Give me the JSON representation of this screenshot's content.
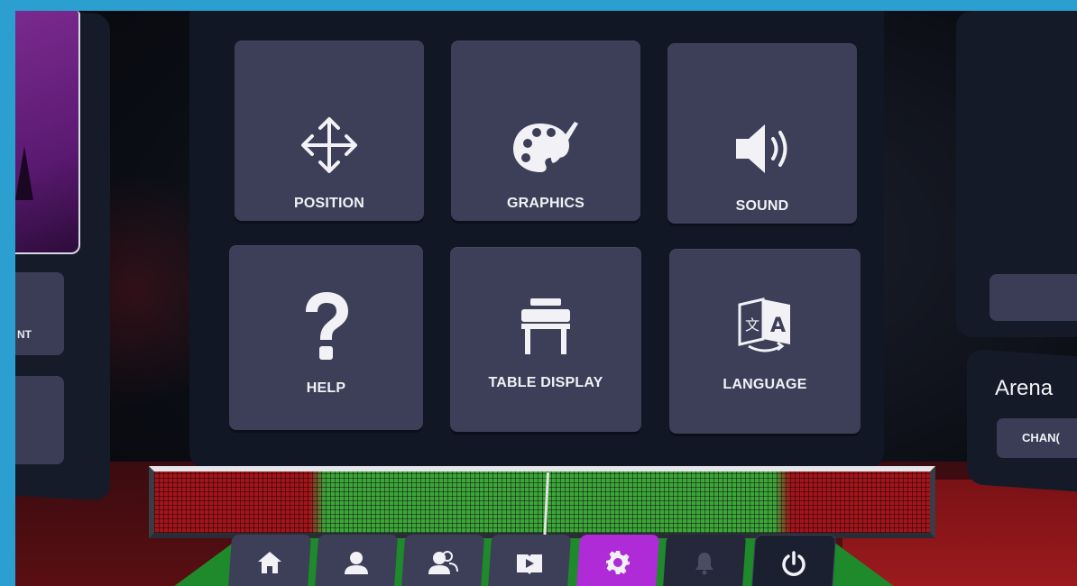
{
  "menu": {
    "tiles": [
      {
        "label": "POSITION",
        "icon": "move-arrows-icon"
      },
      {
        "label": "GRAPHICS",
        "icon": "palette-icon"
      },
      {
        "label": "SOUND",
        "icon": "speaker-icon"
      },
      {
        "label": "HELP",
        "icon": "question-mark-icon"
      },
      {
        "label": "TABLE DISPLAY",
        "icon": "table-icon"
      },
      {
        "label": "LANGUAGE",
        "icon": "translate-icon"
      }
    ]
  },
  "left_panel": {
    "button_label_partial": "NT"
  },
  "right_panel": {
    "title": "Arena",
    "change_button_partial": "CHAN("
  },
  "bottom_nav": {
    "items": [
      {
        "name": "home",
        "icon": "home-icon",
        "state": "normal"
      },
      {
        "name": "profile",
        "icon": "person-icon",
        "state": "normal"
      },
      {
        "name": "friends",
        "icon": "people-icon",
        "state": "normal"
      },
      {
        "name": "tutorial",
        "icon": "book-play-icon",
        "state": "normal"
      },
      {
        "name": "settings",
        "icon": "gear-icon",
        "state": "active"
      },
      {
        "name": "notifications",
        "icon": "bell-icon",
        "state": "disabled"
      },
      {
        "name": "quit",
        "icon": "power-icon",
        "state": "normal"
      }
    ]
  },
  "colors": {
    "tile": "#3d3f58",
    "panel": "#121726",
    "active_nav": "#b02bd8",
    "frame": "#2a9fd0"
  }
}
